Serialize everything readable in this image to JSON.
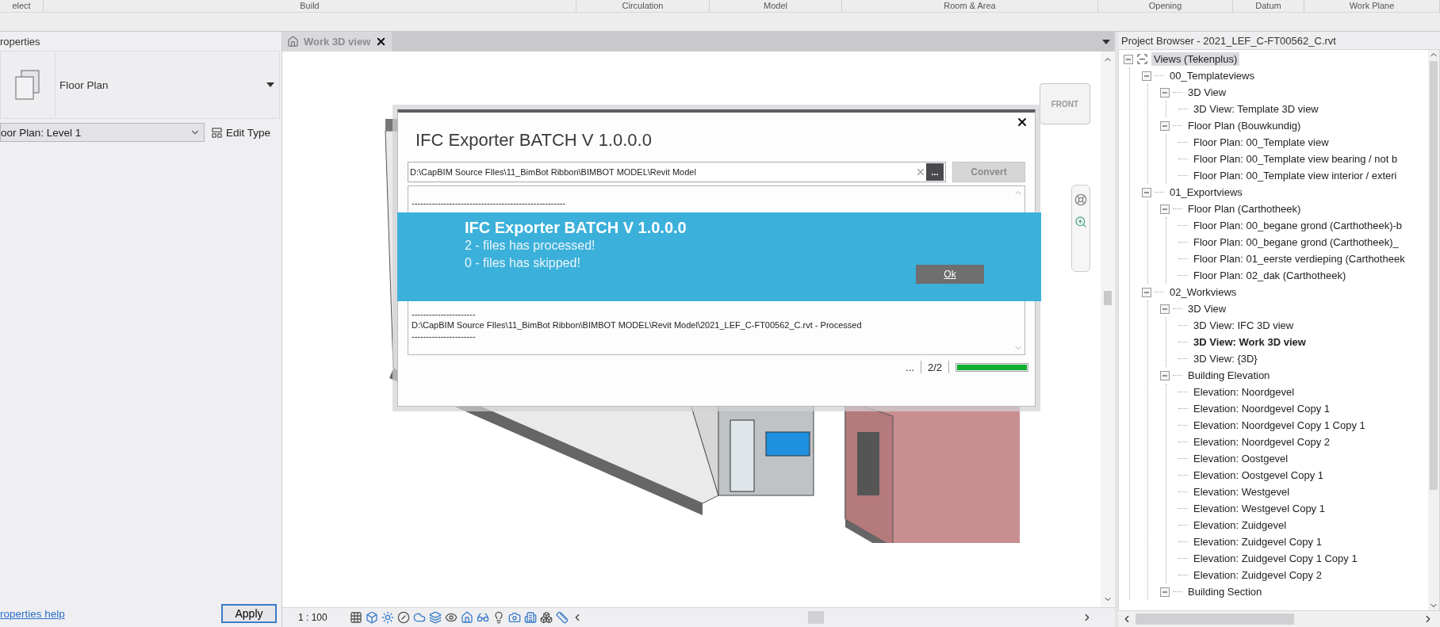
{
  "ribbon": {
    "panels": [
      "elect",
      "Build",
      "Circulation",
      "Model",
      "Room & Area",
      "Opening",
      "Datum",
      "Work Plane"
    ]
  },
  "properties": {
    "title": "roperties",
    "type_name": "Floor Plan",
    "instance": "oor Plan: Level 1",
    "edit_type": "Edit Type",
    "help_link": "roperties help",
    "apply": "Apply"
  },
  "view": {
    "tabs": [
      {
        "label": "Work 3D view",
        "selected": true
      }
    ],
    "viewcube": "FRONT",
    "scale": "1 : 100"
  },
  "dialog": {
    "title": "IFC Exporter BATCH V 1.0.0.0",
    "path": "D:\\CapBIM Source FIles\\11_BimBot Ribbon\\BIMBOT MODEL\\Revit Model",
    "browse": "...",
    "convert": {
      "label": "Convert",
      "disabled": true
    },
    "log_top": [
      "-----------------------------------------------------"
    ],
    "log_bottom": [
      "----------------------",
      "D:\\CapBIM Source FIles\\11_BimBot Ribbon\\BIMBOT MODEL\\Revit Model\\2021_LEF_C-FT00562_C.rvt - Processed",
      "----------------------"
    ],
    "message": {
      "title": "IFC Exporter BATCH V 1.0.0.0",
      "lines": [
        "2 - files has processed!",
        "0 - files has skipped!"
      ],
      "ok": "Ok"
    },
    "status": {
      "ellipsis": "...",
      "count": "2/2",
      "level": 1
    }
  },
  "project_browser": {
    "title": "Project Browser - 2021_LEF_C-FT00562_C.rvt",
    "tree": [
      {
        "label": "Views (Tekenplus)",
        "kind": "root",
        "expanded": true,
        "selected": true,
        "current": false,
        "children": [
          {
            "label": "00_Templateviews",
            "kind": "group",
            "expanded": true,
            "selected": false,
            "current": false,
            "children": [
              {
                "label": "3D View",
                "kind": "group",
                "expanded": true,
                "selected": false,
                "current": false,
                "children": [
                  {
                    "label": "3D View: Template 3D view",
                    "kind": "view",
                    "selected": false,
                    "current": false
                  }
                ]
              },
              {
                "label": "Floor Plan (Bouwkundig)",
                "kind": "group",
                "expanded": true,
                "selected": false,
                "current": false,
                "children": [
                  {
                    "label": "Floor Plan: 00_Template view",
                    "kind": "view",
                    "selected": false,
                    "current": false
                  },
                  {
                    "label": "Floor Plan: 00_Template view bearing / not b",
                    "kind": "view",
                    "selected": false,
                    "current": false
                  },
                  {
                    "label": "Floor Plan: 00_Template view interior / exteri",
                    "kind": "view",
                    "selected": false,
                    "current": false
                  }
                ]
              }
            ]
          },
          {
            "label": "01_Exportviews",
            "kind": "group",
            "expanded": true,
            "selected": false,
            "current": false,
            "children": [
              {
                "label": "Floor Plan (Carthotheek)",
                "kind": "group",
                "expanded": true,
                "selected": false,
                "current": false,
                "children": [
                  {
                    "label": "Floor Plan: 00_begane grond (Carthotheek)-b",
                    "kind": "view",
                    "selected": false,
                    "current": false
                  },
                  {
                    "label": "Floor Plan: 00_begane grond (Carthotheek)_",
                    "kind": "view",
                    "selected": false,
                    "current": false
                  },
                  {
                    "label": "Floor Plan: 01_eerste verdieping (Carthotheek",
                    "kind": "view",
                    "selected": false,
                    "current": false
                  },
                  {
                    "label": "Floor Plan: 02_dak (Carthotheek)",
                    "kind": "view",
                    "selected": false,
                    "current": false
                  }
                ]
              }
            ]
          },
          {
            "label": "02_Workviews",
            "kind": "group",
            "expanded": true,
            "selected": false,
            "current": false,
            "children": [
              {
                "label": "3D View",
                "kind": "group",
                "expanded": true,
                "selected": false,
                "current": false,
                "children": [
                  {
                    "label": "3D View: IFC 3D view",
                    "kind": "view",
                    "selected": false,
                    "current": false
                  },
                  {
                    "label": "3D View: Work 3D view",
                    "kind": "view",
                    "selected": false,
                    "current": true
                  },
                  {
                    "label": "3D View: {3D}",
                    "kind": "view",
                    "selected": false,
                    "current": false
                  }
                ]
              },
              {
                "label": "Building Elevation",
                "kind": "group",
                "expanded": true,
                "selected": false,
                "current": false,
                "children": [
                  {
                    "label": "Elevation: Noordgevel",
                    "kind": "view",
                    "selected": false,
                    "current": false
                  },
                  {
                    "label": "Elevation: Noordgevel Copy 1",
                    "kind": "view",
                    "selected": false,
                    "current": false
                  },
                  {
                    "label": "Elevation: Noordgevel Copy 1 Copy 1",
                    "kind": "view",
                    "selected": false,
                    "current": false
                  },
                  {
                    "label": "Elevation: Noordgevel Copy 2",
                    "kind": "view",
                    "selected": false,
                    "current": false
                  },
                  {
                    "label": "Elevation: Oostgevel",
                    "kind": "view",
                    "selected": false,
                    "current": false
                  },
                  {
                    "label": "Elevation: Oostgevel Copy 1",
                    "kind": "view",
                    "selected": false,
                    "current": false
                  },
                  {
                    "label": "Elevation: Westgevel",
                    "kind": "view",
                    "selected": false,
                    "current": false
                  },
                  {
                    "label": "Elevation: Westgevel Copy 1",
                    "kind": "view",
                    "selected": false,
                    "current": false
                  },
                  {
                    "label": "Elevation: Zuidgevel",
                    "kind": "view",
                    "selected": false,
                    "current": false
                  },
                  {
                    "label": "Elevation: Zuidgevel Copy 1",
                    "kind": "view",
                    "selected": false,
                    "current": false
                  },
                  {
                    "label": "Elevation: Zuidgevel Copy 1 Copy 1",
                    "kind": "view",
                    "selected": false,
                    "current": false
                  },
                  {
                    "label": "Elevation: Zuidgevel Copy 2",
                    "kind": "view",
                    "selected": false,
                    "current": false
                  }
                ]
              },
              {
                "label": "Building Section",
                "kind": "group",
                "expanded": true,
                "selected": false,
                "current": false
              }
            ]
          }
        ]
      }
    ]
  }
}
